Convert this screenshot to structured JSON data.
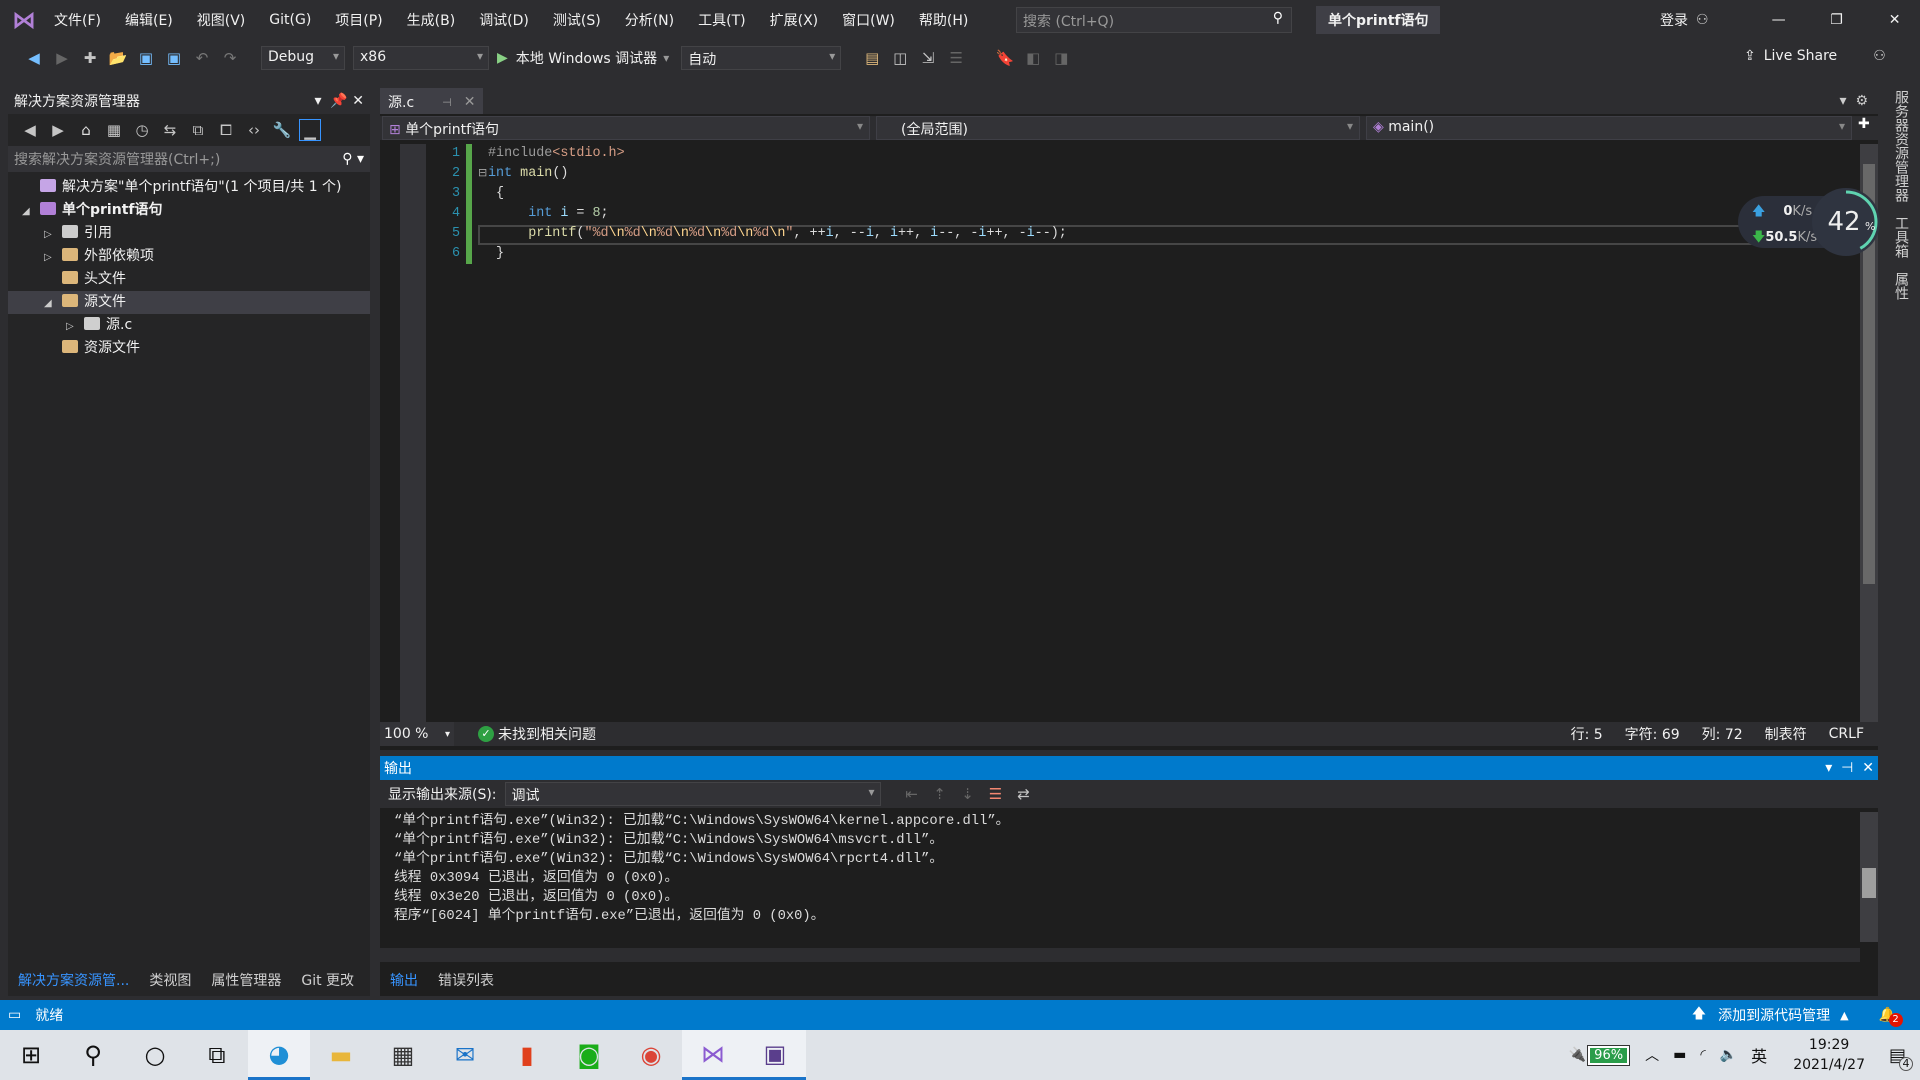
{
  "menu": [
    "文件(F)",
    "编辑(E)",
    "视图(V)",
    "Git(G)",
    "项目(P)",
    "生成(B)",
    "调试(D)",
    "测试(S)",
    "分析(N)",
    "工具(T)",
    "扩展(X)",
    "窗口(W)",
    "帮助(H)"
  ],
  "search_placeholder": "搜索 (Ctrl+Q)",
  "solution_title": "单个printf语句",
  "login": "登录",
  "toolbar": {
    "config": "Debug",
    "platform": "x86",
    "debugger": "本地 Windows 调试器",
    "mode": "自动",
    "live_share": "Live Share"
  },
  "solution_explorer": {
    "title": "解决方案资源管理器",
    "search_placeholder": "搜索解决方案资源管理器(Ctrl+;)",
    "tree": [
      {
        "label": "解决方案\"单个printf语句\"(1 个项目/共 1 个)",
        "depth": 0,
        "arrow": "",
        "icon": "solution-icon",
        "color": "#c5a5e6"
      },
      {
        "label": "单个printf语句",
        "depth": 0,
        "arrow": "◢",
        "icon": "project-icon",
        "color": "#b180d7",
        "bold": true
      },
      {
        "label": "引用",
        "depth": 1,
        "arrow": "▷",
        "icon": "references-icon",
        "color": "#cccccc"
      },
      {
        "label": "外部依赖项",
        "depth": 1,
        "arrow": "▷",
        "icon": "folder-icon",
        "color": "#dcb67a"
      },
      {
        "label": "头文件",
        "depth": 1,
        "arrow": "",
        "icon": "filter-folder-icon",
        "color": "#dcb67a"
      },
      {
        "label": "源文件",
        "depth": 1,
        "arrow": "◢",
        "icon": "filter-folder-icon",
        "color": "#dcb67a",
        "selected": true
      },
      {
        "label": "源.c",
        "depth": 2,
        "arrow": "▷",
        "icon": "c-file-icon",
        "color": "#cfcfcf"
      },
      {
        "label": "资源文件",
        "depth": 1,
        "arrow": "",
        "icon": "filter-folder-icon",
        "color": "#dcb67a"
      }
    ],
    "bottom_tabs": [
      "解决方案资源管...",
      "类视图",
      "属性管理器",
      "Git 更改"
    ]
  },
  "editor": {
    "tab": "源.c",
    "nav_project": "单个printf语句",
    "nav_scope": "(全局范围)",
    "nav_member": "main()",
    "lines": [
      [
        [
          "#include",
          "pp"
        ],
        [
          "<stdio.h>",
          "inc"
        ]
      ],
      [
        [
          "int",
          "kw"
        ],
        [
          " ",
          "plain"
        ],
        [
          "main",
          "fn"
        ],
        [
          "()",
          "plain"
        ]
      ],
      [
        [
          " {",
          "plain"
        ]
      ],
      [
        [
          "     ",
          "plain"
        ],
        [
          "int",
          "kw"
        ],
        [
          " ",
          "plain"
        ],
        [
          "i",
          "var"
        ],
        [
          " = ",
          "plain"
        ],
        [
          "8",
          "num"
        ],
        [
          ";",
          "plain"
        ]
      ],
      [
        [
          "     ",
          "plain"
        ],
        [
          "printf",
          "fn"
        ],
        [
          "(",
          "plain"
        ],
        [
          "\"%d",
          "str"
        ],
        [
          "\\n",
          "esc"
        ],
        [
          "%d",
          "str"
        ],
        [
          "\\n",
          "esc"
        ],
        [
          "%d",
          "str"
        ],
        [
          "\\n",
          "esc"
        ],
        [
          "%d",
          "str"
        ],
        [
          "\\n",
          "esc"
        ],
        [
          "%d",
          "str"
        ],
        [
          "\\n",
          "esc"
        ],
        [
          "%d",
          "str"
        ],
        [
          "\\n",
          "esc"
        ],
        [
          "\"",
          "str"
        ],
        [
          ", ++",
          "plain"
        ],
        [
          "i",
          "var"
        ],
        [
          ", --",
          "plain"
        ],
        [
          "i",
          "var"
        ],
        [
          ", ",
          "plain"
        ],
        [
          "i",
          "var"
        ],
        [
          "++, ",
          "plain"
        ],
        [
          "i",
          "var"
        ],
        [
          "--, -",
          "plain"
        ],
        [
          "i",
          "var"
        ],
        [
          "++, -",
          "plain"
        ],
        [
          "i",
          "var"
        ],
        [
          "--);",
          "plain"
        ]
      ],
      [
        [
          " }",
          "plain"
        ]
      ]
    ],
    "zoom": "100 %",
    "issues": "未找到相关问题",
    "status": {
      "line": "行: 5",
      "char": "字符: 69",
      "col": "列: 72",
      "tabs": "制表符",
      "eol": "CRLF"
    }
  },
  "net_widget": {
    "up": "0",
    "down": "50.5",
    "unit": "K/s",
    "percent": 42
  },
  "output": {
    "title": "输出",
    "source_label": "显示输出来源(S):",
    "source_value": "调试",
    "lines": [
      "“单个printf语句.exe”(Win32): 已加载“C:\\Windows\\SysWOW64\\kernel.appcore.dll”。",
      "“单个printf语句.exe”(Win32): 已加载“C:\\Windows\\SysWOW64\\msvcrt.dll”。",
      "“单个printf语句.exe”(Win32): 已加载“C:\\Windows\\SysWOW64\\rpcrt4.dll”。",
      "线程 0x3094 已退出，返回值为 0 (0x0)。",
      "线程 0x3e20 已退出，返回值为 0 (0x0)。",
      "程序“[6024] 单个printf语句.exe”已退出，返回值为 0 (0x0)。"
    ],
    "bottom_tabs": [
      "输出",
      "错误列表"
    ]
  },
  "right_tabs": [
    "服务器资源管理器",
    "工具箱",
    "属性"
  ],
  "statusbar": {
    "ready": "就绪",
    "source_control": "添加到源代码管理",
    "notifications": "2"
  },
  "taskbar": {
    "battery": "96%",
    "ime": "英",
    "time": "19:29",
    "date": "2021/4/27",
    "action_center": "4"
  },
  "colors": {
    "accent": "#007acc",
    "code_bg": "#1e1e1e",
    "green_bar": "#57a64a"
  }
}
